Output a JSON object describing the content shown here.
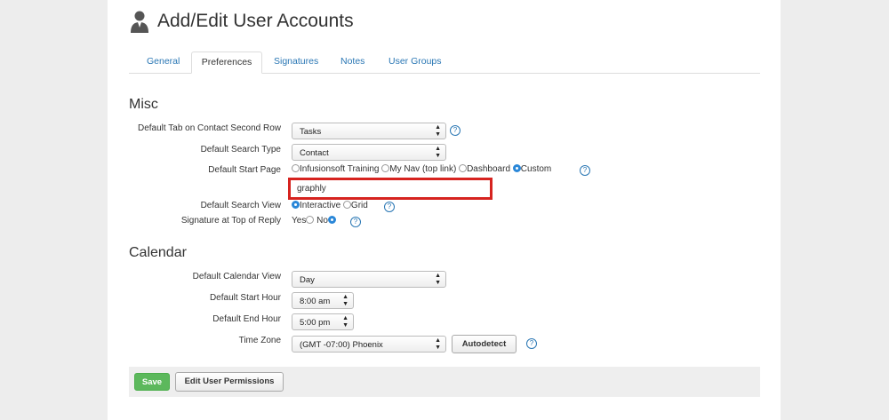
{
  "header": {
    "title": "Add/Edit User Accounts",
    "icon": "user-icon"
  },
  "tabs": [
    {
      "label": "General",
      "active": false
    },
    {
      "label": "Preferences",
      "active": true
    },
    {
      "label": "Signatures",
      "active": false
    },
    {
      "label": "Notes",
      "active": false
    },
    {
      "label": "User Groups",
      "active": false
    }
  ],
  "misc": {
    "title": "Misc",
    "default_tab": {
      "label": "Default Tab on Contact Second Row",
      "value": "Tasks"
    },
    "search_type": {
      "label": "Default Search Type",
      "value": "Contact"
    },
    "start_page": {
      "label": "Default Start Page",
      "options": [
        "Infusionsoft Training",
        "My Nav (top link)",
        "Dashboard",
        "Custom"
      ],
      "selected": "Custom",
      "custom_value": "graphly"
    },
    "search_view": {
      "label": "Default Search View",
      "options": [
        "Interactive",
        "Grid"
      ],
      "selected": "Interactive"
    },
    "signature": {
      "label": "Signature at Top of Reply",
      "options": [
        "Yes",
        "No"
      ],
      "selected": "No"
    }
  },
  "calendar": {
    "title": "Calendar",
    "view": {
      "label": "Default Calendar View",
      "value": "Day"
    },
    "start_hour": {
      "label": "Default Start Hour",
      "value": "8:00 am"
    },
    "end_hour": {
      "label": "Default End Hour",
      "value": "5:00 pm"
    },
    "time_zone": {
      "label": "Time Zone",
      "value": "(GMT -07:00) Phoenix",
      "autodetect_label": "Autodetect"
    }
  },
  "footer": {
    "save_label": "Save",
    "permissions_label": "Edit User Permissions"
  },
  "glyphs": {
    "help": "?",
    "arrows": "▲▼"
  },
  "colors": {
    "link": "#2a77b4",
    "save": "#5cb85c",
    "highlight": "#d6231f",
    "radio_on": "#2a87d8"
  }
}
